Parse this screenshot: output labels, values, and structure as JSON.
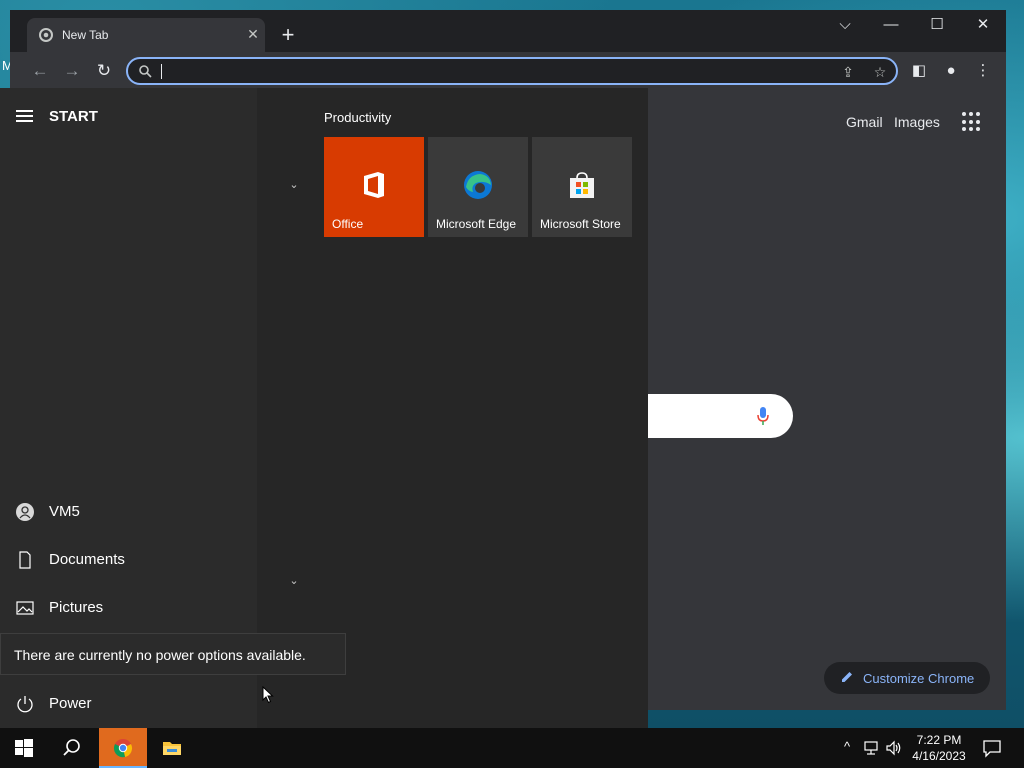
{
  "desktop": {
    "label": "My"
  },
  "browser": {
    "tab": {
      "title": "New Tab",
      "close": "✕"
    },
    "new_tab": "+",
    "window_controls": {
      "tab_search": "⌵",
      "minimize": "—",
      "maximize": "☐",
      "close": "✕"
    },
    "toolbar": {
      "back": "←",
      "forward": "→",
      "reload": "↻",
      "share_icon": "⇪",
      "star_icon": "☆",
      "sidebar_icon": "◧",
      "profile_icon": "●",
      "menu_icon": "⋮"
    },
    "omnibox": {
      "value": ""
    },
    "page": {
      "gmail": "Gmail",
      "images": "Images",
      "customize": "Customize Chrome"
    }
  },
  "start_menu": {
    "title": "START",
    "group_title": "Productivity",
    "tiles": [
      {
        "label": "Office",
        "color": "#d83b01"
      },
      {
        "label": "Microsoft Edge"
      },
      {
        "label": "Microsoft Store"
      }
    ],
    "sidebar": {
      "user": "VM5",
      "documents": "Documents",
      "pictures": "Pictures",
      "power": "Power"
    },
    "tooltip": "There are currently no power options available."
  },
  "taskbar": {
    "clock_time": "7:22 PM",
    "clock_date": "4/16/2023",
    "tray_chevron": "^"
  }
}
